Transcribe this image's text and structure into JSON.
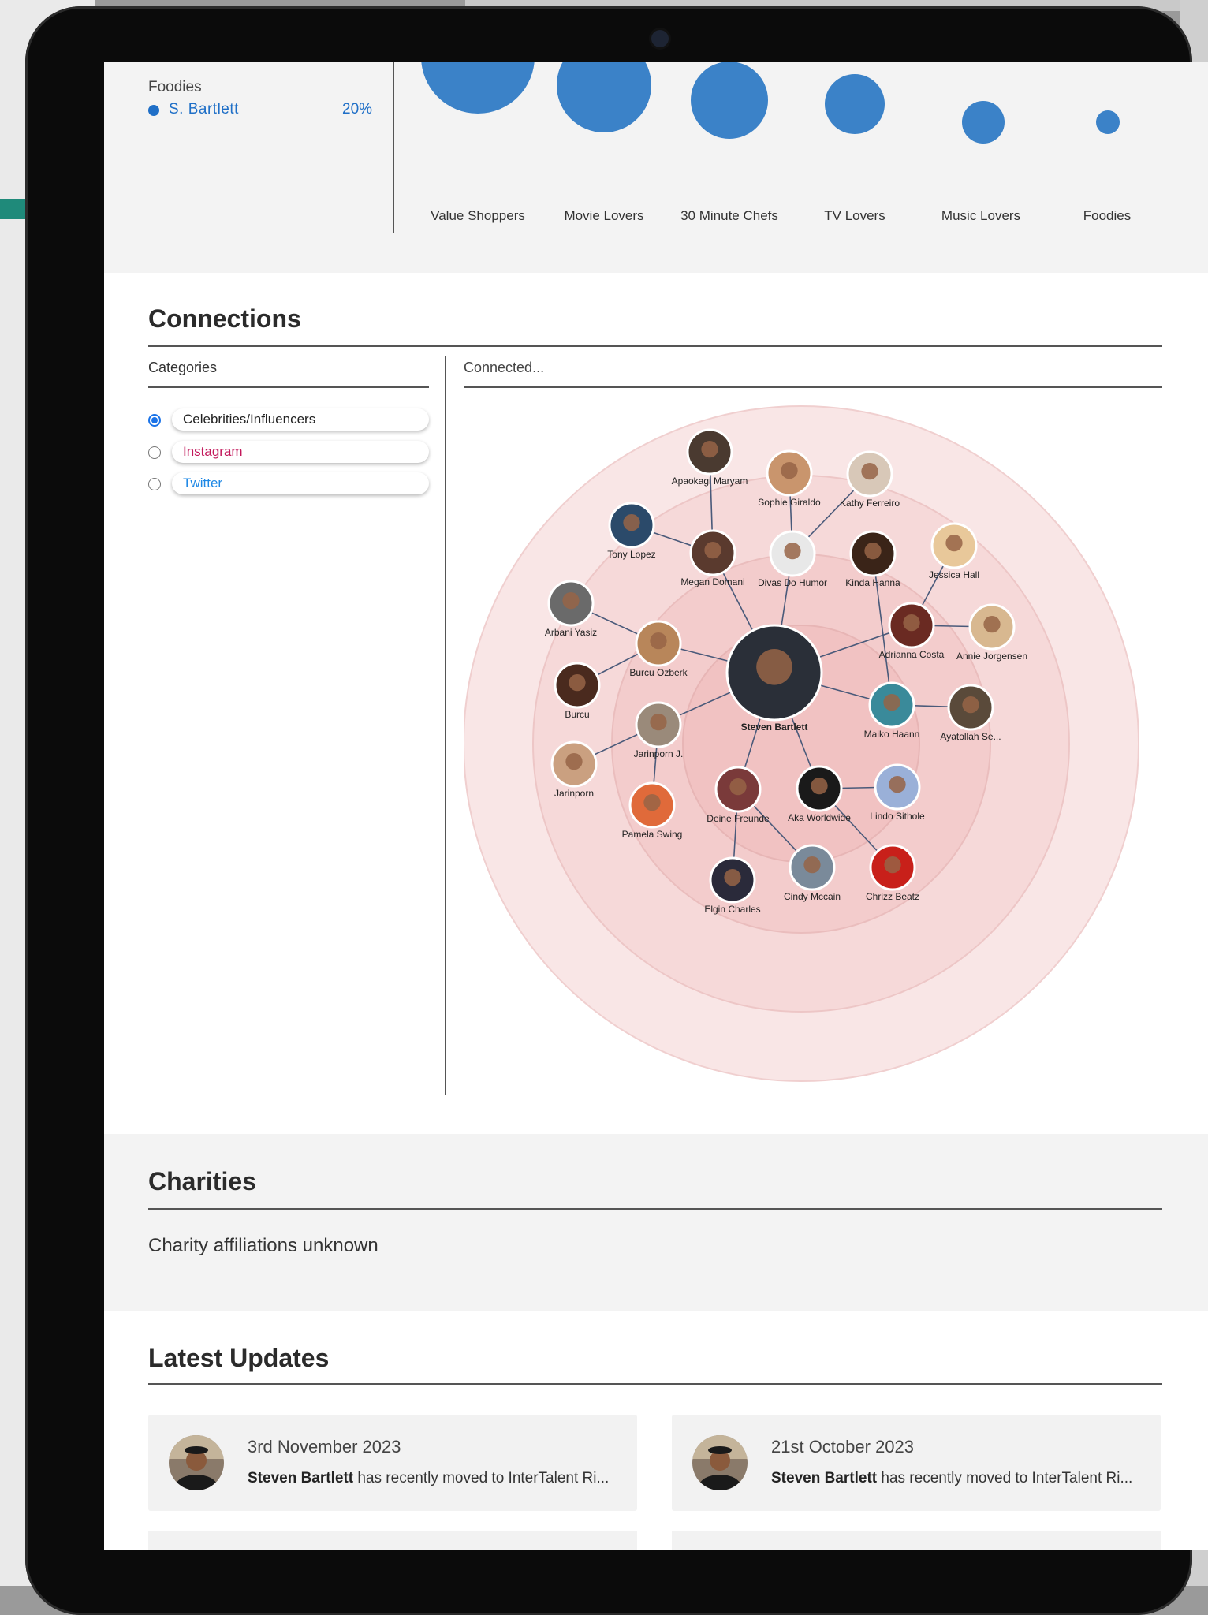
{
  "interests": {
    "legend_heading": "Foodies",
    "legend_entry": {
      "name": "S. Bartlett",
      "percent": "20%",
      "color": "#1f6fc7"
    },
    "bubbles": [
      {
        "label": "Value Shoppers"
      },
      {
        "label": "Movie Lovers"
      },
      {
        "label": "30 Minute Chefs"
      },
      {
        "label": "TV Lovers"
      },
      {
        "label": "Music Lovers"
      },
      {
        "label": "Foodies"
      }
    ],
    "bubble_color": "#3b82c8"
  },
  "connections": {
    "title": "Connections",
    "categories_label": "Categories",
    "connected_label": "Connected...",
    "categories": [
      {
        "label": "Celebrities/Influencers",
        "selected": true,
        "color": "#222222"
      },
      {
        "label": "Instagram",
        "selected": false,
        "color": "#c2185b"
      },
      {
        "label": "Twitter",
        "selected": false,
        "color": "#1e88e5"
      }
    ],
    "center": "Steven Bartlett",
    "nodes": [
      "Apaokagi Maryam",
      "Sophie Giraldo",
      "Kathy Ferreiro",
      "Tony Lopez",
      "Megan Domani",
      "Divas Do Humor",
      "Kinda Hanna",
      "Jessica Hall",
      "Arbani Yasiz",
      "Burcu Ozberk",
      "Adrianna Costa",
      "Annie Jorgensen",
      "Burcu",
      "Maiko Haann",
      "Ayatollah Se...",
      "Jarinporn J.",
      "Jarinporn",
      "Deine Freunde",
      "Aka Worldwide",
      "Lindo Sithole",
      "Pamela Swing",
      "Elgin Charles",
      "Cindy Mccain",
      "Chrizz Beatz"
    ]
  },
  "charities": {
    "title": "Charities",
    "text": "Charity affiliations unknown"
  },
  "updates": {
    "title": "Latest Updates",
    "items": [
      {
        "date": "3rd November 2023",
        "name": "Steven Bartlett",
        "text": " has recently moved to InterTalent Ri..."
      },
      {
        "date": "21st October 2023",
        "name": "Steven Bartlett",
        "text": " has recently moved to InterTalent Ri..."
      }
    ]
  }
}
